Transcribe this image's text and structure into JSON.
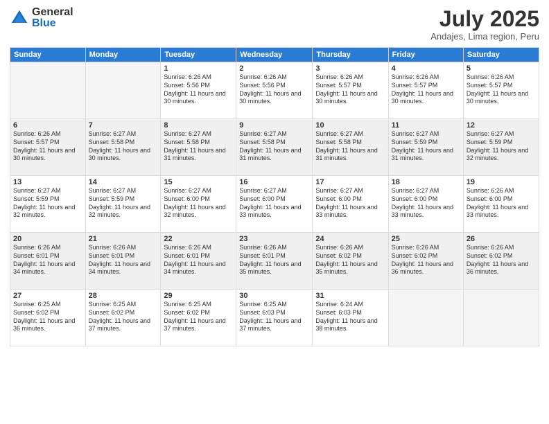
{
  "header": {
    "logo_general": "General",
    "logo_blue": "Blue",
    "month_title": "July 2025",
    "location": "Andajes, Lima region, Peru"
  },
  "days_of_week": [
    "Sunday",
    "Monday",
    "Tuesday",
    "Wednesday",
    "Thursday",
    "Friday",
    "Saturday"
  ],
  "weeks": [
    [
      {
        "day": "",
        "sunrise": "",
        "sunset": "",
        "daylight": "",
        "empty": true
      },
      {
        "day": "",
        "sunrise": "",
        "sunset": "",
        "daylight": "",
        "empty": true
      },
      {
        "day": "1",
        "sunrise": "Sunrise: 6:26 AM",
        "sunset": "Sunset: 5:56 PM",
        "daylight": "Daylight: 11 hours and 30 minutes."
      },
      {
        "day": "2",
        "sunrise": "Sunrise: 6:26 AM",
        "sunset": "Sunset: 5:56 PM",
        "daylight": "Daylight: 11 hours and 30 minutes."
      },
      {
        "day": "3",
        "sunrise": "Sunrise: 6:26 AM",
        "sunset": "Sunset: 5:57 PM",
        "daylight": "Daylight: 11 hours and 30 minutes."
      },
      {
        "day": "4",
        "sunrise": "Sunrise: 6:26 AM",
        "sunset": "Sunset: 5:57 PM",
        "daylight": "Daylight: 11 hours and 30 minutes."
      },
      {
        "day": "5",
        "sunrise": "Sunrise: 6:26 AM",
        "sunset": "Sunset: 5:57 PM",
        "daylight": "Daylight: 11 hours and 30 minutes."
      }
    ],
    [
      {
        "day": "6",
        "sunrise": "Sunrise: 6:26 AM",
        "sunset": "Sunset: 5:57 PM",
        "daylight": "Daylight: 11 hours and 30 minutes."
      },
      {
        "day": "7",
        "sunrise": "Sunrise: 6:27 AM",
        "sunset": "Sunset: 5:58 PM",
        "daylight": "Daylight: 11 hours and 30 minutes."
      },
      {
        "day": "8",
        "sunrise": "Sunrise: 6:27 AM",
        "sunset": "Sunset: 5:58 PM",
        "daylight": "Daylight: 11 hours and 31 minutes."
      },
      {
        "day": "9",
        "sunrise": "Sunrise: 6:27 AM",
        "sunset": "Sunset: 5:58 PM",
        "daylight": "Daylight: 11 hours and 31 minutes."
      },
      {
        "day": "10",
        "sunrise": "Sunrise: 6:27 AM",
        "sunset": "Sunset: 5:58 PM",
        "daylight": "Daylight: 11 hours and 31 minutes."
      },
      {
        "day": "11",
        "sunrise": "Sunrise: 6:27 AM",
        "sunset": "Sunset: 5:59 PM",
        "daylight": "Daylight: 11 hours and 31 minutes."
      },
      {
        "day": "12",
        "sunrise": "Sunrise: 6:27 AM",
        "sunset": "Sunset: 5:59 PM",
        "daylight": "Daylight: 11 hours and 32 minutes."
      }
    ],
    [
      {
        "day": "13",
        "sunrise": "Sunrise: 6:27 AM",
        "sunset": "Sunset: 5:59 PM",
        "daylight": "Daylight: 11 hours and 32 minutes."
      },
      {
        "day": "14",
        "sunrise": "Sunrise: 6:27 AM",
        "sunset": "Sunset: 5:59 PM",
        "daylight": "Daylight: 11 hours and 32 minutes."
      },
      {
        "day": "15",
        "sunrise": "Sunrise: 6:27 AM",
        "sunset": "Sunset: 6:00 PM",
        "daylight": "Daylight: 11 hours and 32 minutes."
      },
      {
        "day": "16",
        "sunrise": "Sunrise: 6:27 AM",
        "sunset": "Sunset: 6:00 PM",
        "daylight": "Daylight: 11 hours and 33 minutes."
      },
      {
        "day": "17",
        "sunrise": "Sunrise: 6:27 AM",
        "sunset": "Sunset: 6:00 PM",
        "daylight": "Daylight: 11 hours and 33 minutes."
      },
      {
        "day": "18",
        "sunrise": "Sunrise: 6:27 AM",
        "sunset": "Sunset: 6:00 PM",
        "daylight": "Daylight: 11 hours and 33 minutes."
      },
      {
        "day": "19",
        "sunrise": "Sunrise: 6:26 AM",
        "sunset": "Sunset: 6:00 PM",
        "daylight": "Daylight: 11 hours and 33 minutes."
      }
    ],
    [
      {
        "day": "20",
        "sunrise": "Sunrise: 6:26 AM",
        "sunset": "Sunset: 6:01 PM",
        "daylight": "Daylight: 11 hours and 34 minutes."
      },
      {
        "day": "21",
        "sunrise": "Sunrise: 6:26 AM",
        "sunset": "Sunset: 6:01 PM",
        "daylight": "Daylight: 11 hours and 34 minutes."
      },
      {
        "day": "22",
        "sunrise": "Sunrise: 6:26 AM",
        "sunset": "Sunset: 6:01 PM",
        "daylight": "Daylight: 11 hours and 34 minutes."
      },
      {
        "day": "23",
        "sunrise": "Sunrise: 6:26 AM",
        "sunset": "Sunset: 6:01 PM",
        "daylight": "Daylight: 11 hours and 35 minutes."
      },
      {
        "day": "24",
        "sunrise": "Sunrise: 6:26 AM",
        "sunset": "Sunset: 6:02 PM",
        "daylight": "Daylight: 11 hours and 35 minutes."
      },
      {
        "day": "25",
        "sunrise": "Sunrise: 6:26 AM",
        "sunset": "Sunset: 6:02 PM",
        "daylight": "Daylight: 11 hours and 36 minutes."
      },
      {
        "day": "26",
        "sunrise": "Sunrise: 6:26 AM",
        "sunset": "Sunset: 6:02 PM",
        "daylight": "Daylight: 11 hours and 36 minutes."
      }
    ],
    [
      {
        "day": "27",
        "sunrise": "Sunrise: 6:25 AM",
        "sunset": "Sunset: 6:02 PM",
        "daylight": "Daylight: 11 hours and 36 minutes."
      },
      {
        "day": "28",
        "sunrise": "Sunrise: 6:25 AM",
        "sunset": "Sunset: 6:02 PM",
        "daylight": "Daylight: 11 hours and 37 minutes."
      },
      {
        "day": "29",
        "sunrise": "Sunrise: 6:25 AM",
        "sunset": "Sunset: 6:02 PM",
        "daylight": "Daylight: 11 hours and 37 minutes."
      },
      {
        "day": "30",
        "sunrise": "Sunrise: 6:25 AM",
        "sunset": "Sunset: 6:03 PM",
        "daylight": "Daylight: 11 hours and 37 minutes."
      },
      {
        "day": "31",
        "sunrise": "Sunrise: 6:24 AM",
        "sunset": "Sunset: 6:03 PM",
        "daylight": "Daylight: 11 hours and 38 minutes."
      },
      {
        "day": "",
        "sunrise": "",
        "sunset": "",
        "daylight": "",
        "empty": true
      },
      {
        "day": "",
        "sunrise": "",
        "sunset": "",
        "daylight": "",
        "empty": true
      }
    ]
  ]
}
